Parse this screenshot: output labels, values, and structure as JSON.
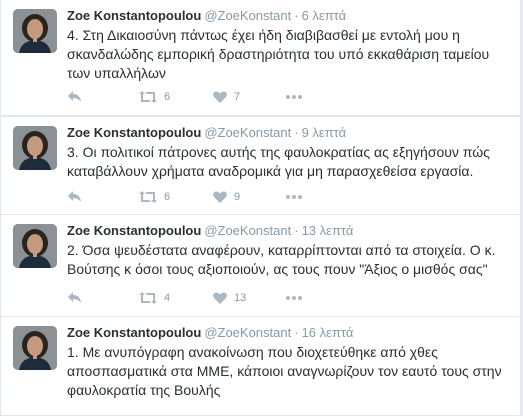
{
  "tweets": [
    {
      "name": "Zoe Konstantopoulou",
      "handle": "@ZoeKonstant",
      "sep": "·",
      "time": "6 λεπτά",
      "text": "4. Στη Δικαιοσύνη πάντως έχει ήδη διαβιβασθεί με εντολή μου η σκανδαλώδης εμπορική δραστηριότητα του υπό εκκαθάριση ταμείου των υπαλλήλων",
      "retweets": "6",
      "likes": "7"
    },
    {
      "name": "Zoe Konstantopoulou",
      "handle": "@ZoeKonstant",
      "sep": "·",
      "time": "9 λεπτά",
      "text": "3. Οι πολιτικοί πάτρονες αυτής της φαυλοκρατίας ας εξηγήσουν πώς καταβάλλουν χρήματα αναδρομικά για μη παρασχεθείσα εργασία.",
      "retweets": "6",
      "likes": "9"
    },
    {
      "name": "Zoe Konstantopoulou",
      "handle": "@ZoeKonstant",
      "sep": "·",
      "time": "13 λεπτά",
      "text": "2. Όσα ψευδέστατα αναφέρουν, καταρρίπτονται από τα στοιχεία. Ο κ. Βούτσης κ όσοι τους αξιοποιούν, ας τους πουν \"Άξιος ο μισθός σας\"",
      "retweets": "4",
      "likes": "13"
    },
    {
      "name": "Zoe Konstantopoulou",
      "handle": "@ZoeKonstant",
      "sep": "·",
      "time": "16 λεπτά",
      "text": "1. Με ανυπόγραφη ανακοίνωση που διοχετεύθηκε από χθες αποσπασματικά στα ΜΜΕ, κάποιοι αναγνωρίζουν τον εαυτό τους στην φαυλοκρατία της Βουλής",
      "retweets": "",
      "likes": ""
    }
  ],
  "icons": {
    "reply": "reply-icon",
    "retweet": "retweet-icon",
    "like": "heart-icon",
    "more": "more-icon"
  },
  "colors": {
    "background": "#e6ecf0",
    "card": "#ffffff",
    "muted": "#8899a6",
    "icon": "#aab8c2",
    "text": "#292f33"
  }
}
